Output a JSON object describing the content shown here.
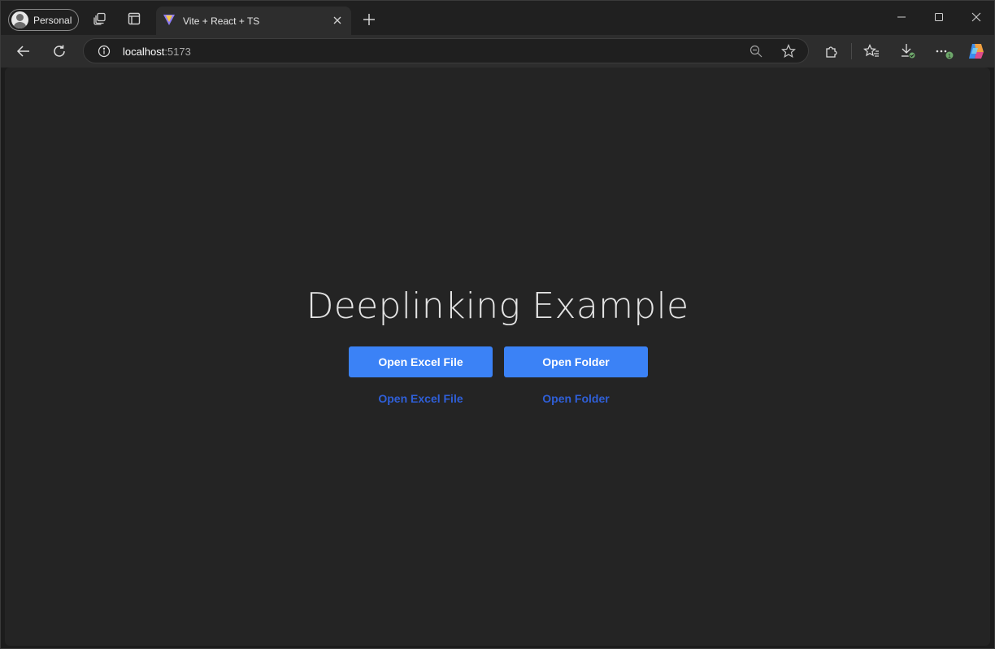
{
  "browser": {
    "profile_label": "Personal",
    "tab_title": "Vite + React + TS",
    "url_host": "localhost",
    "url_port": ":5173",
    "download_badge": "1"
  },
  "page": {
    "title": "Deeplinking Example",
    "buttons": [
      {
        "label": "Open Excel File"
      },
      {
        "label": "Open Folder"
      }
    ],
    "links": [
      {
        "label": "Open Excel File"
      },
      {
        "label": "Open Folder"
      }
    ]
  },
  "colors": {
    "accent": "#3b82f6",
    "link": "#2f5fd8",
    "page_bg": "#242424"
  }
}
